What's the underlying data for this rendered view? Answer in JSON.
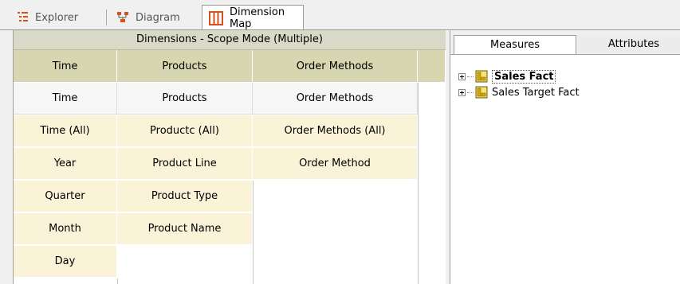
{
  "tabs": [
    {
      "label": "Explorer",
      "icon": "explorer-icon",
      "active": false
    },
    {
      "label": "Diagram",
      "icon": "diagram-icon",
      "active": false
    },
    {
      "label": "Dimension Map",
      "icon": "dimension-map-icon",
      "active": true
    }
  ],
  "dimensions_panel": {
    "title": "Dimensions - Scope Mode (Multiple)",
    "columns": [
      "Time",
      "Products",
      "Order Methods"
    ],
    "selected_row": [
      "Time",
      "Products",
      "Order Methods"
    ],
    "levels": {
      "time": [
        "Time (All)",
        "Year",
        "Quarter",
        "Month",
        "Day"
      ],
      "products": [
        "Productc (All)",
        "Product Line",
        "Product Type",
        "Product Name"
      ],
      "order_methods": [
        "Order Methods (All)",
        "Order Method"
      ]
    }
  },
  "right_panel": {
    "tabs": [
      "Measures",
      "Attributes"
    ],
    "active_tab": "Measures",
    "tree": [
      {
        "label": "Sales Fact",
        "selected": true
      },
      {
        "label": "Sales Target Fact",
        "selected": false
      }
    ]
  },
  "colors": {
    "header_bg": "#d9d9c7",
    "column_header_bg": "#d6d6b0",
    "level_bg": "#faf3d8",
    "accent_orange": "#d9501a"
  }
}
